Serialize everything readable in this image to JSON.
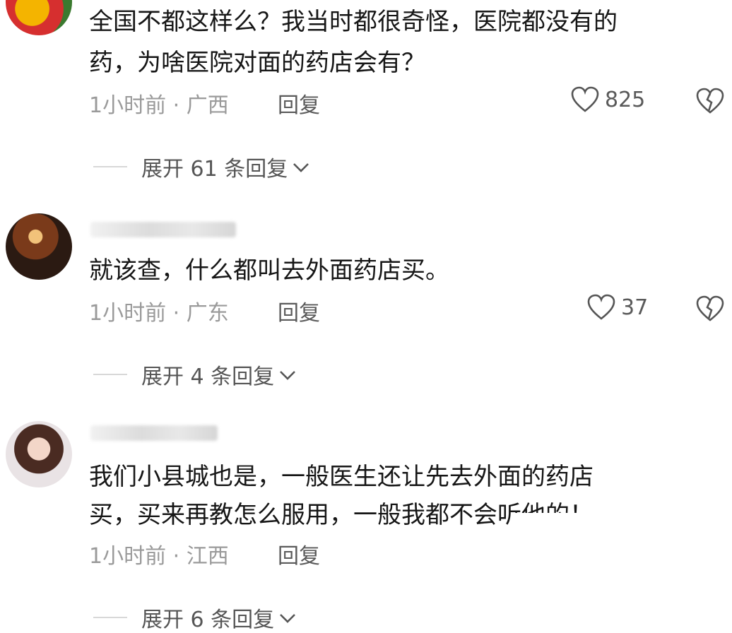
{
  "comments": [
    {
      "text_lines": [
        "全国不都这样么？我当时都很奇怪，医院都没有的",
        "药，为啥医院对面的药店会有？"
      ],
      "time_location": "1小时前 · 广西",
      "reply_label": "回复",
      "likes": "825",
      "expand_label": "展开 61 条回复"
    },
    {
      "text_lines": [
        "就该查，什么都叫去外面药店买。"
      ],
      "time_location": "1小时前 · 广东",
      "reply_label": "回复",
      "likes": "37",
      "expand_label": "展开 4 条回复"
    },
    {
      "text_lines": [
        "我们小县城也是，一般医生还让先去外面的药店",
        "买，买来再教怎么服用，一般我都不会听他的！"
      ],
      "time_location": "1小时前 · 江西",
      "reply_label": "回复",
      "expand_label": "展开 6 条回复"
    }
  ],
  "icons": {
    "like": "heart-outline-icon",
    "dislike": "broken-heart-icon",
    "expand": "chevron-down-icon"
  },
  "colors": {
    "meta": "#9a9a9a",
    "text": "#161616"
  }
}
